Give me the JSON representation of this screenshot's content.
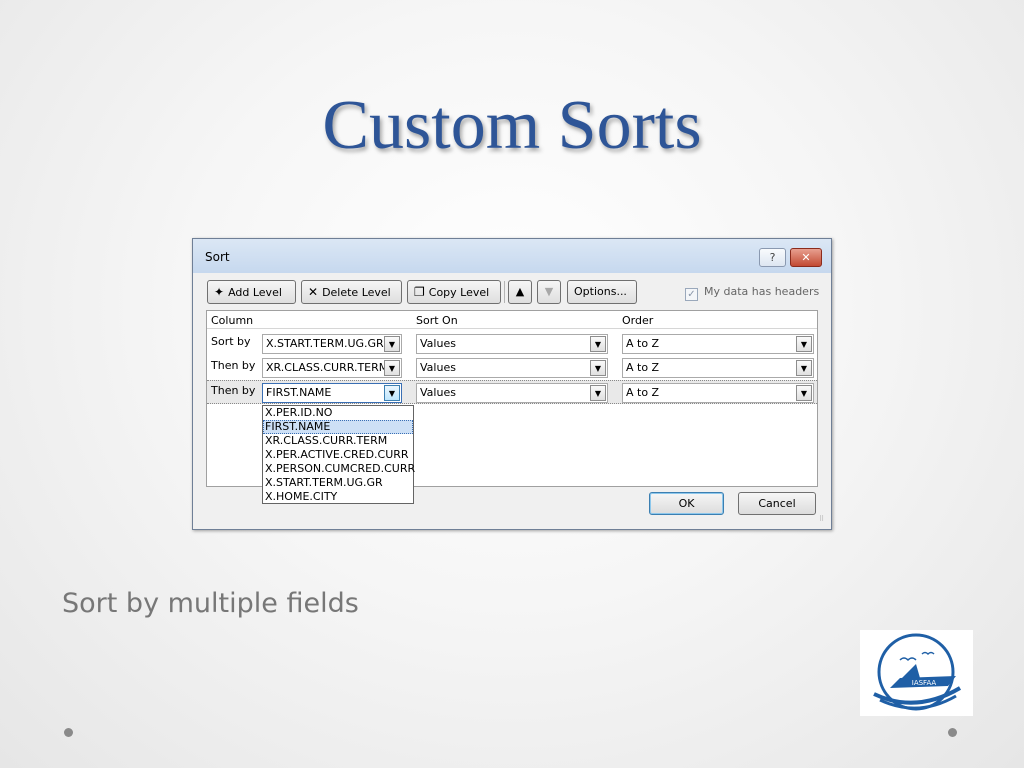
{
  "slide": {
    "title": "Custom Sorts",
    "subtitle": "Sort by multiple fields",
    "logo_text": "IASFAA"
  },
  "dialog": {
    "title": "Sort",
    "help_label": "?",
    "close_label": "✕",
    "toolbar": {
      "add_level": "Add Level",
      "delete_level": "Delete Level",
      "copy_level": "Copy Level",
      "options": "Options...",
      "move_up": "▲",
      "move_down": "▼"
    },
    "headers_checkbox": {
      "label": "My data has headers",
      "checked": true
    },
    "grid_headers": {
      "column": "Column",
      "sort_on": "Sort On",
      "order": "Order"
    },
    "rows": [
      {
        "label": "Sort by",
        "column": "X.START.TERM.UG.GR",
        "sort_on": "Values",
        "order": "A to Z"
      },
      {
        "label": "Then by",
        "column": "XR.CLASS.CURR.TERM",
        "sort_on": "Values",
        "order": "A to Z"
      },
      {
        "label": "Then by",
        "column": "FIRST.NAME",
        "sort_on": "Values",
        "order": "A to Z"
      }
    ],
    "dropdown_options": [
      "X.PER.ID.NO",
      "FIRST.NAME",
      "XR.CLASS.CURR.TERM",
      "X.PER.ACTIVE.CRED.CURR",
      "X.PERSON.CUMCRED.CURR",
      "X.START.TERM.UG.GR",
      "X.HOME.CITY"
    ],
    "dropdown_highlighted": "FIRST.NAME",
    "ok_label": "OK",
    "cancel_label": "Cancel"
  },
  "colors": {
    "title": "#2e5597",
    "subtitle": "#777777",
    "logo_blue": "#1f5fa6"
  }
}
